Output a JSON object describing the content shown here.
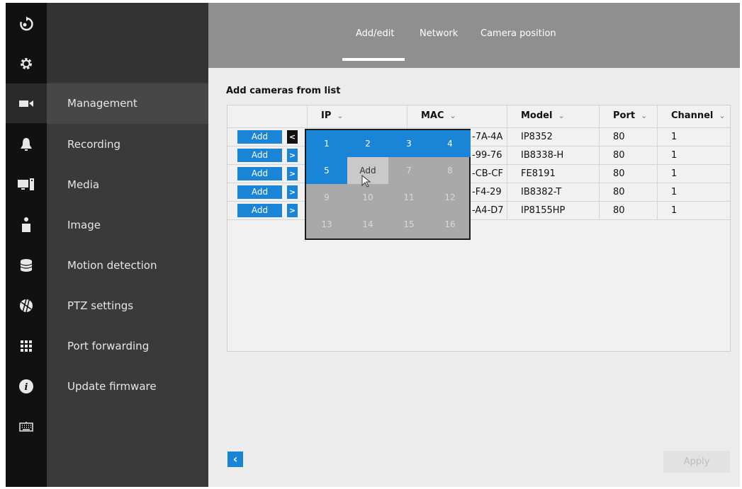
{
  "tabs": [
    "Add/edit",
    "Network",
    "Camera position"
  ],
  "menu": [
    "Management",
    "Recording",
    "Media",
    "Image",
    "Motion detection",
    "PTZ settings",
    "Port forwarding",
    "Update firmware"
  ],
  "section_title": "Add cameras from list",
  "columns": [
    "IP",
    "MAC",
    "Model",
    "Port",
    "Channel"
  ],
  "rows": [
    {
      "add": "Add",
      "mac_suffix": "-7A-4A",
      "model": "IP8352",
      "port": "80",
      "channel": "1"
    },
    {
      "add": "Add",
      "mac_suffix": "-99-76",
      "model": "IB8338-H",
      "port": "80",
      "channel": "1"
    },
    {
      "add": "Add",
      "mac_suffix": "-CB-CF",
      "model": "FE8191",
      "port": "80",
      "channel": "1"
    },
    {
      "add": "Add",
      "mac_suffix": "-F4-29",
      "model": "IB8382-T",
      "port": "80",
      "channel": "1"
    },
    {
      "add": "Add",
      "mac_suffix": "-A4-D7",
      "model": "IP8155HP",
      "port": "80",
      "channel": "1"
    }
  ],
  "channels": [
    "1",
    "2",
    "3",
    "4",
    "5",
    "Add",
    "7",
    "8",
    "9",
    "10",
    "11",
    "12",
    "13",
    "14",
    "15",
    "16"
  ],
  "apply_label": "Apply",
  "icons": {
    "sidebar": [
      "logout-icon",
      "gear-icon",
      "camera-icon",
      "bell-icon",
      "monitor-icon",
      "person-icon",
      "storage-icon",
      "globe-icon",
      "grid-icon",
      "info-icon",
      "keyboard-icon"
    ],
    "column_sort": "chevron-down-icon",
    "back": "chevron-left-icon",
    "cursor": "mouse-cursor-icon"
  },
  "colors": {
    "accent": "#1a84d6",
    "sidebar_dark": "#111111",
    "menu": "#3a3a3a",
    "header": "#8f8f8f"
  }
}
